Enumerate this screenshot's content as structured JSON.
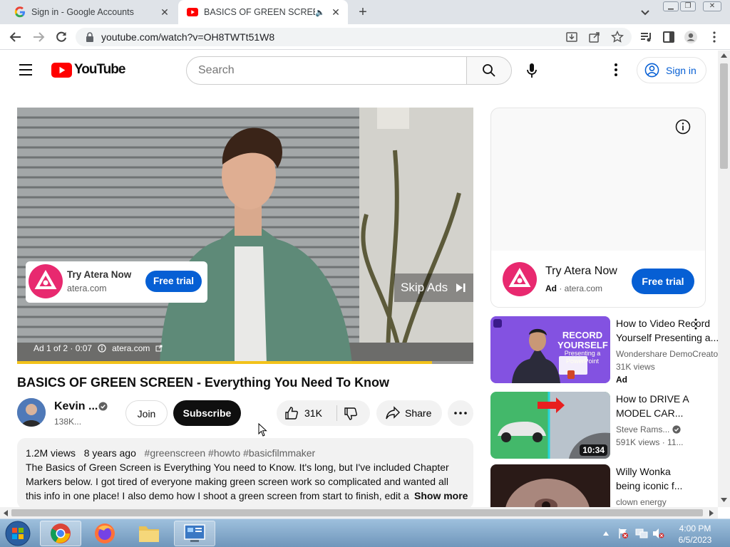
{
  "browser": {
    "tabs": [
      {
        "title": "Sign in - Google Accounts",
        "favicon": "google-icon"
      },
      {
        "title": "BASICS OF GREEN SCREEN -",
        "favicon": "youtube-icon",
        "audio": "speaker-icon"
      }
    ],
    "new_tab": "+",
    "url": "youtube.com/watch?v=OH8TWTt51W8"
  },
  "youtube": {
    "logo_text": "YouTube",
    "search_placeholder": "Search",
    "sign_in": "Sign in"
  },
  "player": {
    "ad_card": {
      "title": "Try Atera Now",
      "domain": "atera.com",
      "cta": "Free trial"
    },
    "skip_label": "Skip Ads",
    "ad_counter": "Ad 1 of 2 · 0:07",
    "ad_domain": "atera.com",
    "progress_fraction": 0.91
  },
  "video": {
    "title": "BASICS OF GREEN SCREEN - Everything You Need To Know",
    "channel": "Kevin ...",
    "subscribers": "138K...",
    "join": "Join",
    "subscribe": "Subscribe",
    "likes": "31K",
    "share": "Share",
    "description": {
      "views": "1.2M views",
      "age": "8 years ago",
      "tags": "#greenscreen #howto #basicfilmmaker",
      "line1": "The Basics of Green Screen is Everything You need to Know. It's long, but I've included Chapter",
      "line2": "Markers below. I got tired of everyone making green screen work so complicated and wanted all",
      "line3": "this info in one place!  I also demo how I shoot a green screen from start to finish, edit a",
      "show_more": "Show more"
    }
  },
  "side_ad": {
    "title": "Try Atera Now",
    "ad_label": "Ad",
    "domain": "atera.com",
    "cta": "Free trial"
  },
  "recommendations": [
    {
      "title1": "How to Video Record",
      "title2": "Yourself Presenting a...",
      "channel": "Wondershare DemoCreator",
      "views": "31K views",
      "extra": "Ad",
      "thumb_text": "RECORD YOURSELF",
      "thumb_sub": "Presenting a PowerPoint"
    },
    {
      "title1": "How to DRIVE A",
      "title2": "MODEL CAR...",
      "channel": "Steve Rams...",
      "views": "591K views · 11...",
      "duration": "10:34"
    },
    {
      "title1": "Willy Wonka",
      "title2": "being iconic f...",
      "channel": "clown energy"
    }
  ],
  "taskbar": {
    "time": "4:00 PM",
    "date": "6/5/2023"
  }
}
